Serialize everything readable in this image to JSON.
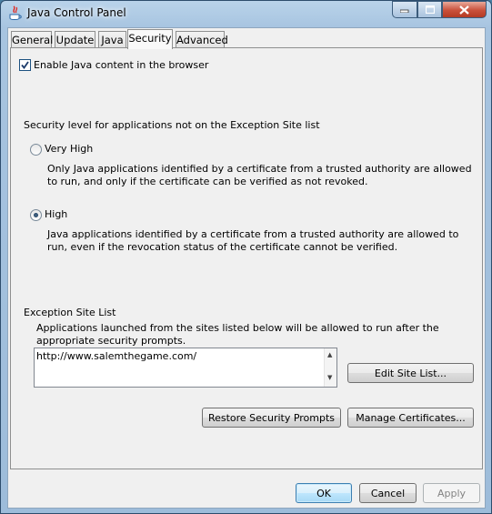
{
  "window": {
    "title": "Java Control Panel"
  },
  "tabs": [
    {
      "label": "General"
    },
    {
      "label": "Update"
    },
    {
      "label": "Java"
    },
    {
      "label": "Security"
    },
    {
      "label": "Advanced"
    }
  ],
  "active_tab": "Security",
  "security": {
    "enable_java_label": "Enable Java content in the browser",
    "enable_java_checked": true,
    "level_heading": "Security level for applications not on the Exception Site list",
    "options": [
      {
        "label": "Very High",
        "selected": false,
        "description": "Only Java applications identified by a certificate from a trusted authority are allowed to run, and only if the certificate can be verified as not revoked."
      },
      {
        "label": "High",
        "selected": true,
        "description": "Java applications identified by a certificate from a trusted authority are allowed to run, even if the revocation status of the certificate cannot be verified."
      }
    ],
    "exception_heading": "Exception Site List",
    "exception_description": "Applications launched from the sites listed below will be allowed to run after the appropriate security prompts.",
    "exception_sites": [
      "http://www.salemthegame.com/"
    ],
    "edit_site_list_label": "Edit Site List...",
    "restore_prompts_label": "Restore Security Prompts",
    "manage_certificates_label": "Manage Certificates..."
  },
  "footer": {
    "ok_label": "OK",
    "cancel_label": "Cancel",
    "apply_label": "Apply"
  },
  "colors": {
    "title_bar": "#a7c4e0",
    "close_button": "#c9503a",
    "panel_background": "#f0f0f0",
    "default_button": "#bee6fd"
  }
}
